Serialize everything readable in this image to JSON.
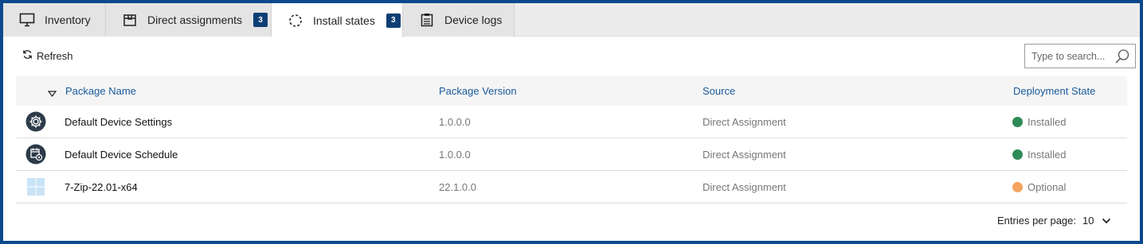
{
  "tabs": [
    {
      "label": "Inventory",
      "icon": "monitor-icon"
    },
    {
      "label": "Direct assignments",
      "icon": "package-box-icon",
      "badge": "3"
    },
    {
      "label": "Install states",
      "icon": "loading-spinner-icon",
      "badge": "3",
      "active": true
    },
    {
      "label": "Device logs",
      "icon": "clipboard-list-icon"
    }
  ],
  "toolbar": {
    "refresh_label": "Refresh",
    "search_placeholder": "Type to search..."
  },
  "table": {
    "columns": [
      "Package Name",
      "Package Version",
      "Source",
      "Deployment State"
    ],
    "rows": [
      {
        "icon": "gear-icon",
        "name": "Default Device Settings",
        "version": "1.0.0.0",
        "source": "Direct Assignment",
        "state": "Installed",
        "state_color": "#2e8b57"
      },
      {
        "icon": "schedule-gear-icon",
        "name": "Default Device Schedule",
        "version": "1.0.0.0",
        "source": "Direct Assignment",
        "state": "Installed",
        "state_color": "#2e8b57"
      },
      {
        "icon": "windows-logo-icon",
        "name": "7-Zip-22.01-x64",
        "version": "22.1.0.0",
        "source": "Direct Assignment",
        "state": "Optional",
        "state_color": "#f4a460"
      }
    ]
  },
  "pagination": {
    "label": "Entries per page:",
    "value": "10"
  },
  "colors": {
    "frame": "#0a4a8c",
    "badge": "#0e3f74",
    "header_link": "#1a5a9c"
  }
}
